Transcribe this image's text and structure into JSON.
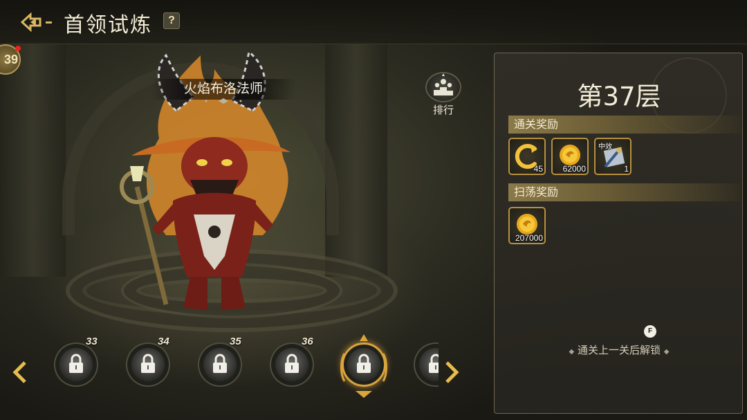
{
  "header": {
    "title": "首领试炼",
    "help_label": "?"
  },
  "player": {
    "level_badge": "39"
  },
  "boss": {
    "name": "火焰布洛法师"
  },
  "rank": {
    "label": "排行"
  },
  "levels": [
    {
      "number": "33",
      "locked": true
    },
    {
      "number": "34",
      "locked": true
    },
    {
      "number": "35",
      "locked": true
    },
    {
      "number": "36",
      "locked": true
    },
    {
      "number": "",
      "locked": true,
      "current": true
    },
    {
      "number": "",
      "locked": true
    }
  ],
  "panel": {
    "floor_title": "第37层",
    "clear_rewards_label": "通关奖励",
    "clear_rewards": [
      {
        "icon": "refresh-c-icon",
        "qty": "45"
      },
      {
        "icon": "gold-coin-icon",
        "qty": "62000"
      },
      {
        "icon": "potion-scroll-icon",
        "tag": "中效",
        "qty": "1"
      }
    ],
    "sweep_rewards_label": "扫荡奖励",
    "sweep_rewards": [
      {
        "icon": "gold-coin-icon",
        "qty": "207000"
      }
    ],
    "key_hint": "F",
    "unlock_hint": "通关上一关后解锁"
  },
  "colors": {
    "accent_gold": "#d8a43c",
    "panel_border": "#6e6753"
  }
}
